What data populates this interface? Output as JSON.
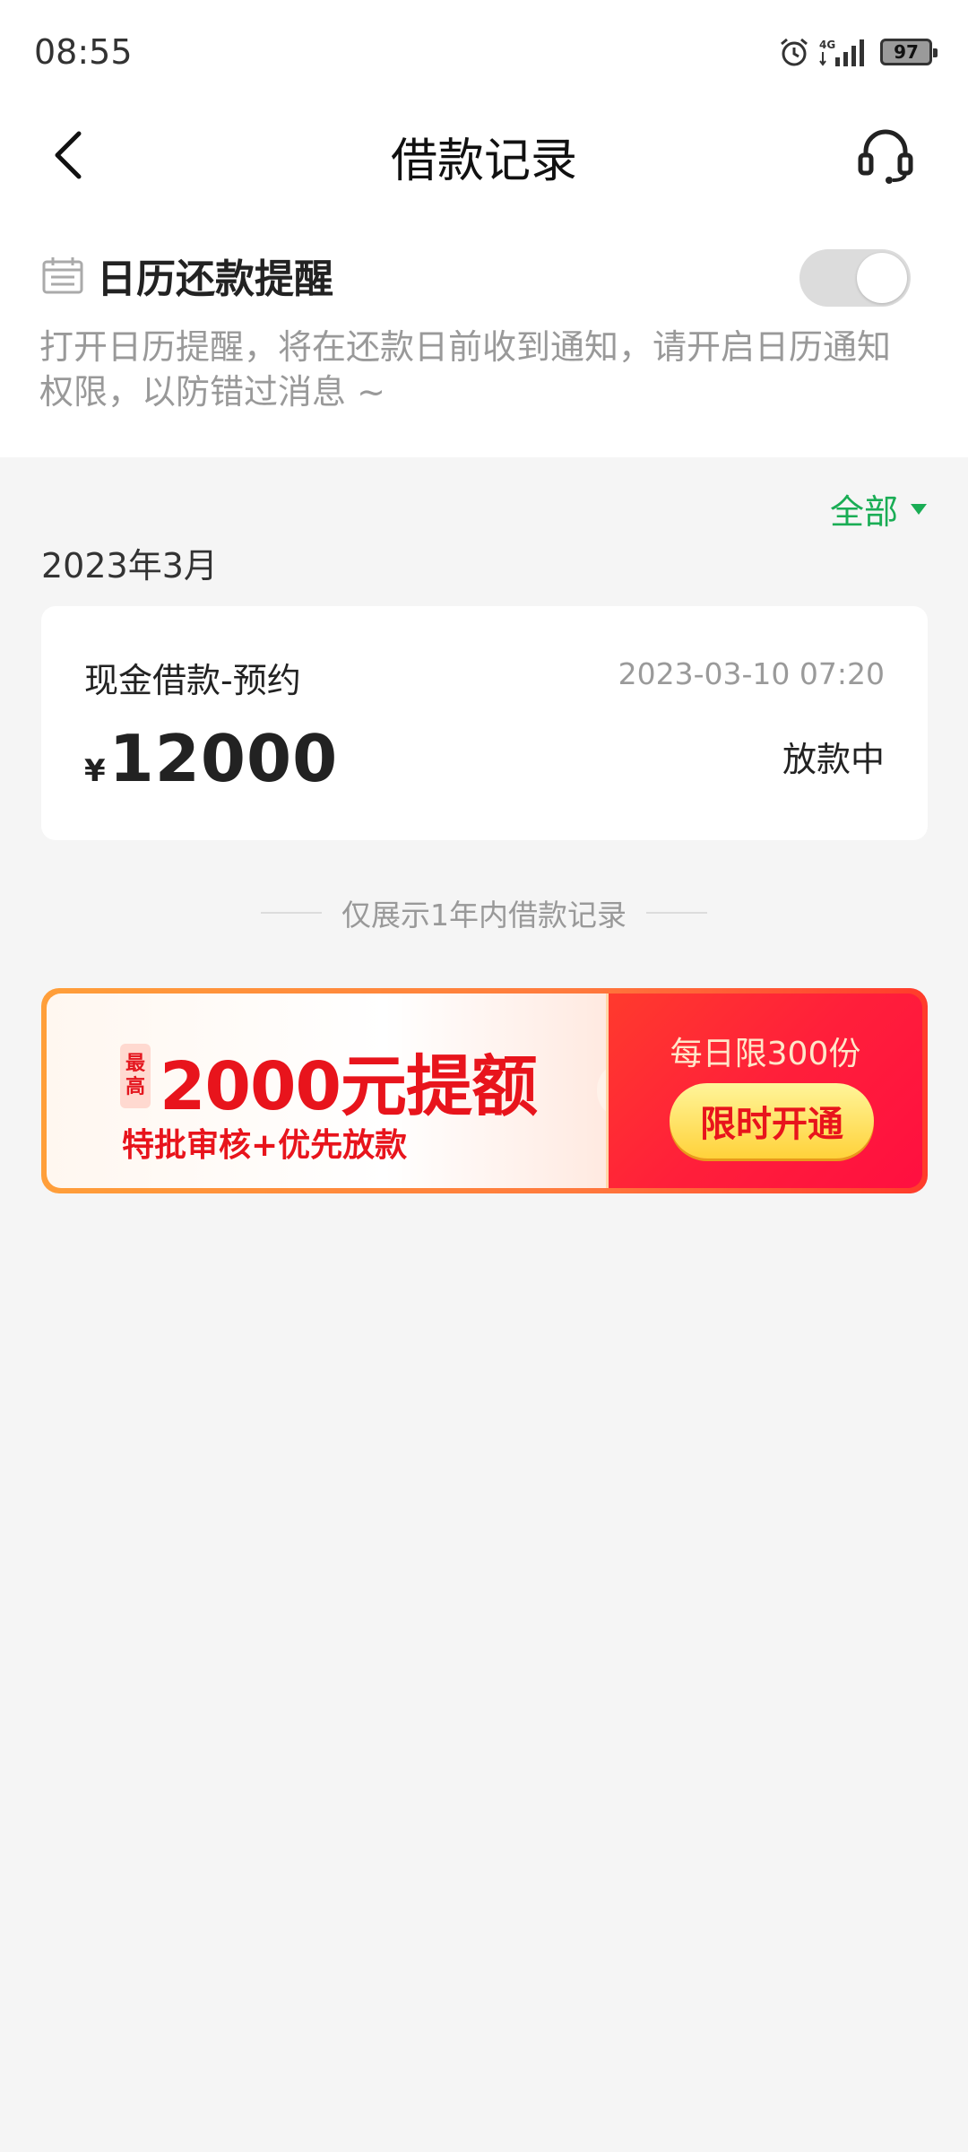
{
  "status_bar": {
    "time": "08:55",
    "network": "4G",
    "battery": "97"
  },
  "nav": {
    "title": "借款记录",
    "back_icon": "chevron-left-icon",
    "service_icon": "headset-icon"
  },
  "reminder": {
    "title": "日历还款提醒",
    "description": "打开日历提醒，将在还款日前收到通知，请开启日历通知权限，以防错过消息 ~",
    "toggle_on": false,
    "icon": "calendar-icon"
  },
  "filter": {
    "label": "全部",
    "color": "#1aad55"
  },
  "records": {
    "month": "2023年3月",
    "items": [
      {
        "type": "现金借款-预约",
        "datetime": "2023-03-10 07:20",
        "currency": "¥",
        "amount": "12000",
        "status": "放款中"
      }
    ]
  },
  "note": "仅展示1年内借款记录",
  "banner": {
    "tag_top": "最",
    "tag_bottom": "高",
    "headline": "2000元提额",
    "subline": "特批审核+优先放款",
    "limit_text": "每日限300份",
    "button_label": "限时开通",
    "accent": "#e8141c"
  }
}
